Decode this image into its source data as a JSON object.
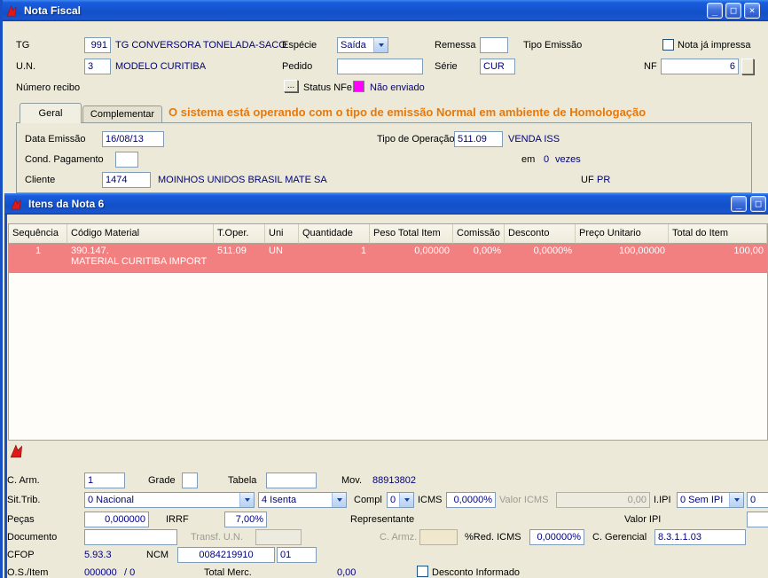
{
  "window": {
    "title": "Nota Fiscal",
    "controls": {
      "minimize": "_",
      "maximize": "□",
      "close": "×"
    }
  },
  "header": {
    "tg_label": "TG",
    "tg_value": "991",
    "tg_desc": "TG CONVERSORA TONELADA-SACO",
    "especie_label": "Espécie",
    "especie_value": "Saída",
    "remessa_label": "Remessa",
    "remessa_value": "",
    "tipo_emissao_label": "Tipo Emissão",
    "nota_impressa_label": "Nota já impressa",
    "un_label": "U.N.",
    "un_value": "3",
    "un_desc": "MODELO CURITIBA",
    "pedido_label": "Pedido",
    "pedido_value": "",
    "serie_label": "Série",
    "serie_value": "CUR",
    "nf_label": "NF",
    "nf_value": "6",
    "numero_recibo_label": "Número recibo",
    "recibo_button": "...",
    "status_nfe_label": "Status NFe",
    "status_nfe_text": "Não enviado"
  },
  "tabs": {
    "geral": "Geral",
    "complementar": "Complementar"
  },
  "message": "O sistema está operando com o tipo de emissão Normal em ambiente de Homologação",
  "geral": {
    "data_emissao_label": "Data Emissão",
    "data_emissao_value": "16/08/13",
    "tipo_operacao_label": "Tipo de Operação",
    "tipo_operacao_value": "511.09",
    "tipo_operacao_desc": "VENDA ISS",
    "cond_pagamento_label": "Cond. Pagamento",
    "cond_pagamento_value": "",
    "em_label": "em",
    "parcelas_value": "0",
    "vezes_label": "vezes",
    "cliente_label": "Cliente",
    "cliente_value": "1474",
    "cliente_desc": "MOINHOS UNIDOS BRASIL MATE SA",
    "uf_label": "UF",
    "uf_value": "PR"
  },
  "items_window": {
    "title": "Itens da Nota 6",
    "columns": [
      "Sequência",
      "Código Material",
      "T.Oper.",
      "Uni",
      "Quantidade",
      "Peso Total Item",
      "Comissão",
      "Desconto",
      "Preço Unitario",
      "Total do Item"
    ],
    "selected_row": {
      "sequencia": "1",
      "codigo_material": "390.147.",
      "material_desc": "MATERIAL CURITIBA IMPORT",
      "t_oper": "511.09",
      "uni": "UN",
      "quantidade": "1",
      "peso_total_item": "0,00000",
      "comissao": "0,00%",
      "desconto": "0,0000%",
      "preco_unitario": "100,00000",
      "total_item": "100,00"
    }
  },
  "detail": {
    "c_arm_label": "C. Arm.",
    "c_arm_value": "1",
    "grade_label": "Grade",
    "grade_value": "",
    "tabela_label": "Tabela",
    "tabela_value": "",
    "mov_label": "Mov.",
    "mov_value": "88913802",
    "sit_trib_label": "Sit.Trib.",
    "sit_trib_value": "0 Nacional",
    "isenta_value": "4 Isenta",
    "compl_label": "Compl",
    "compl_value": "0",
    "icms_label": "ICMS",
    "icms_value": "0,0000%",
    "valor_icms_label": "Valor ICMS",
    "valor_icms_value": "0,00",
    "iipi_label": "I.IPI",
    "iipi_value": "0 Sem IPI",
    "iipi_extra_value": "0",
    "pecas_label": "Peças",
    "pecas_value": "0,000000",
    "irrf_label": "IRRF",
    "irrf_value": "7,00%",
    "representante_label": "Representante",
    "valor_ipi_label": "Valor IPI",
    "valor_ipi_value": "",
    "documento_label": "Documento",
    "documento_value": "",
    "transf_un_label": "Transf. U.N.",
    "transf_un_value": "",
    "c_armz_transf_label": "C. Armz. Transf.",
    "c_armz_transf_value": "",
    "red_icms_label": "%Red. ICMS",
    "red_icms_value": "0,00000%",
    "c_gerencial_label": "C. Gerencial",
    "c_gerencial_value": "8.3.1.1.03",
    "cfop_label": "CFOP",
    "cfop_value": "5.93.3",
    "ncm_label": "NCM",
    "ncm_value": "0084219910",
    "ncm_extra_value": "01",
    "os_item_label": "O.S./Item",
    "os_item_value": "000000",
    "os_item_suffix": "/ 0",
    "total_merc_label": "Total Merc.",
    "total_merc_value": "0,00",
    "desconto_informado_label": "Desconto Informado"
  },
  "colors": {
    "titlebar_blue": "#1254D6",
    "row_highlight": "#F28080",
    "status_nfe_swatch": "#FF00FF",
    "warning_orange": "#E8780A",
    "value_navy": "#000080"
  }
}
